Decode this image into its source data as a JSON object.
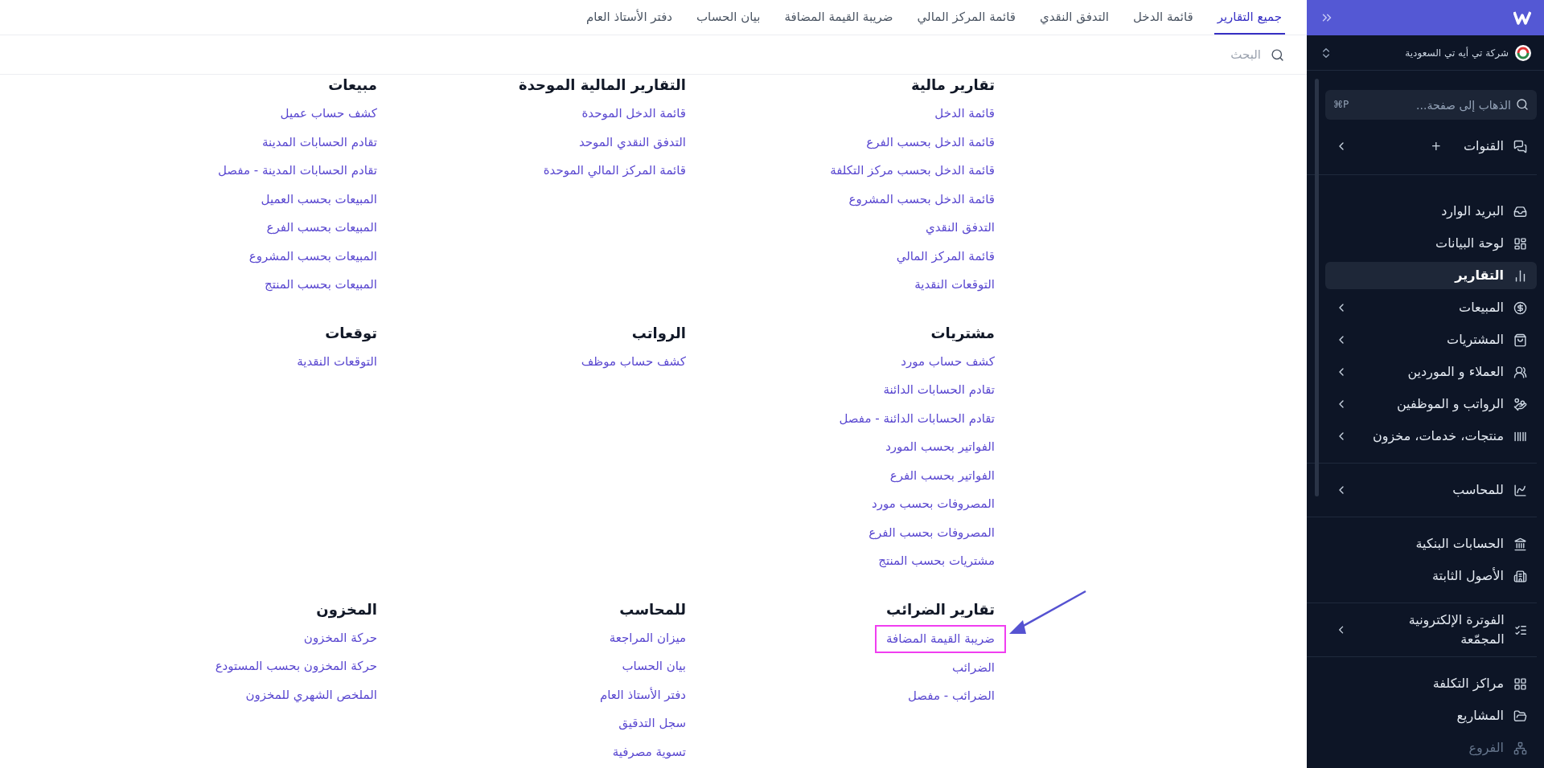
{
  "sidebar": {
    "company": "شركة تي أيه تي السعودية",
    "search": {
      "placeholder": "الذهاب إلى صفحة...",
      "shortcut": "⌘P"
    },
    "groups": [
      {
        "items": [
          {
            "label": "القنوات",
            "badge": "+",
            "expandable": true,
            "selected": false,
            "disabled": false
          }
        ]
      },
      {
        "items": [
          {
            "label": "البريد الوارد",
            "expandable": false,
            "selected": false,
            "disabled": false
          },
          {
            "label": "لوحة البيانات",
            "expandable": false,
            "selected": false,
            "disabled": false
          },
          {
            "label": "التقارير",
            "expandable": false,
            "selected": true,
            "disabled": false
          },
          {
            "label": "المبيعات",
            "expandable": true,
            "selected": false,
            "disabled": false
          },
          {
            "label": "المشتريات",
            "expandable": true,
            "selected": false,
            "disabled": false
          },
          {
            "label": "العملاء و الموردين",
            "expandable": true,
            "selected": false,
            "disabled": false
          },
          {
            "label": "الرواتب و الموظفين",
            "expandable": true,
            "selected": false,
            "disabled": false
          },
          {
            "label": "منتجات، خدمات، مخزون",
            "expandable": true,
            "selected": false,
            "disabled": false
          }
        ]
      },
      {
        "items": [
          {
            "label": "للمحاسب",
            "expandable": true,
            "selected": false,
            "disabled": false
          }
        ]
      },
      {
        "items": [
          {
            "label": "الحسابات البنكية",
            "expandable": false,
            "selected": false,
            "disabled": false
          },
          {
            "label": "الأصول الثابتة",
            "expandable": false,
            "selected": false,
            "disabled": false
          }
        ]
      },
      {
        "items": [
          {
            "label": "الفوترة الإلكترونية المجمّعة",
            "expandable": true,
            "selected": false,
            "disabled": false
          }
        ]
      },
      {
        "items": [
          {
            "label": "مراكز التكلفة",
            "expandable": false,
            "selected": false,
            "disabled": false
          },
          {
            "label": "المشاريع",
            "expandable": false,
            "selected": false,
            "disabled": false
          },
          {
            "label": "الفروع",
            "expandable": false,
            "selected": false,
            "disabled": true
          }
        ]
      }
    ]
  },
  "tabs": [
    {
      "label": "جميع التقارير",
      "selected": true
    },
    {
      "label": "قائمة الدخل",
      "selected": false
    },
    {
      "label": "التدفق النقدي",
      "selected": false
    },
    {
      "label": "قائمة المركز المالي",
      "selected": false
    },
    {
      "label": "ضريبة القيمة المضافة",
      "selected": false
    },
    {
      "label": "بيان الحساب",
      "selected": false
    },
    {
      "label": "دفتر الأستاذ العام",
      "selected": false
    }
  ],
  "search": {
    "placeholder": "البحث"
  },
  "sections": [
    {
      "title": "تقارير مالية",
      "items": [
        {
          "label": "قائمة الدخل",
          "highlighted": false
        },
        {
          "label": "قائمة الدخل بحسب الفرع",
          "highlighted": false
        },
        {
          "label": "قائمة الدخل بحسب مركز التكلفة",
          "highlighted": false
        },
        {
          "label": "قائمة الدخل بحسب المشروع",
          "highlighted": false
        },
        {
          "label": "التدفق النقدي",
          "highlighted": false
        },
        {
          "label": "قائمة المركز المالي",
          "highlighted": false
        },
        {
          "label": "التوقعات النقدية",
          "highlighted": false
        }
      ]
    },
    {
      "title": "التقارير المالية الموحدة",
      "items": [
        {
          "label": "قائمة الدخل الموحدة",
          "highlighted": false
        },
        {
          "label": "التدفق النقدي الموحد",
          "highlighted": false
        },
        {
          "label": "قائمة المركز المالي الموحدة",
          "highlighted": false
        }
      ]
    },
    {
      "title": "مبيعات",
      "items": [
        {
          "label": "كشف حساب عميل",
          "highlighted": false
        },
        {
          "label": "تقادم الحسابات المدينة",
          "highlighted": false
        },
        {
          "label": "تقادم الحسابات المدينة - مفصل",
          "highlighted": false
        },
        {
          "label": "المبيعات بحسب العميل",
          "highlighted": false
        },
        {
          "label": "المبيعات بحسب الفرع",
          "highlighted": false
        },
        {
          "label": "المبيعات بحسب المشروع",
          "highlighted": false
        },
        {
          "label": "المبيعات بحسب المنتج",
          "highlighted": false
        }
      ]
    },
    {
      "title": "مشتريات",
      "items": [
        {
          "label": "كشف حساب مورد",
          "highlighted": false
        },
        {
          "label": "تقادم الحسابات الدائنة",
          "highlighted": false
        },
        {
          "label": "تقادم الحسابات الدائنة - مفصل",
          "highlighted": false
        },
        {
          "label": "الفواتير بحسب المورد",
          "highlighted": false
        },
        {
          "label": "الفواتير بحسب الفرع",
          "highlighted": false
        },
        {
          "label": "المصروفات بحسب مورد",
          "highlighted": false
        },
        {
          "label": "المصروفات بحسب الفرع",
          "highlighted": false
        },
        {
          "label": "مشتريات بحسب المنتج",
          "highlighted": false
        }
      ]
    },
    {
      "title": "الرواتب",
      "items": [
        {
          "label": "كشف حساب موظف",
          "highlighted": false
        }
      ]
    },
    {
      "title": "توقعات",
      "items": [
        {
          "label": "التوقعات النقدية",
          "highlighted": false
        }
      ]
    },
    {
      "title": "تقارير الضرائب",
      "items": [
        {
          "label": "ضريبة القيمة المضافة",
          "highlighted": true
        },
        {
          "label": "الضرائب",
          "highlighted": false
        },
        {
          "label": "الضرائب - مفصل",
          "highlighted": false
        }
      ]
    },
    {
      "title": "للمحاسب",
      "items": [
        {
          "label": "ميزان المراجعة",
          "highlighted": false
        },
        {
          "label": "بيان الحساب",
          "highlighted": false
        },
        {
          "label": "دفتر الأستاذ العام",
          "highlighted": false
        },
        {
          "label": "سجل التدقيق",
          "highlighted": false
        },
        {
          "label": "تسوية مصرفية",
          "highlighted": false
        }
      ]
    },
    {
      "title": "المخزون",
      "items": [
        {
          "label": "حركة المخزون",
          "highlighted": false
        },
        {
          "label": "حركة المخزون بحسب المستودع",
          "highlighted": false
        },
        {
          "label": "الملخص الشهري للمخزون",
          "highlighted": false
        }
      ]
    }
  ]
}
